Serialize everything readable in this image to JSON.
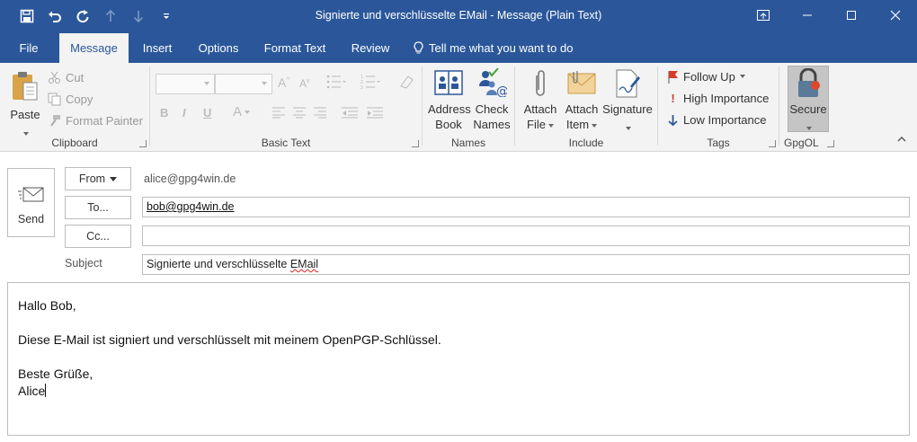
{
  "window": {
    "title": "Signierte und verschlüsselte EMail  -  Message (Plain Text)"
  },
  "colors": {
    "accent": "#2b579a",
    "ribbon_bg": "#f3f3f3",
    "secure_bg": "#c5c5c5"
  },
  "qat": [
    {
      "icon": "save-icon"
    },
    {
      "icon": "undo-icon"
    },
    {
      "icon": "redo-icon"
    },
    {
      "icon": "up-arrow-icon"
    },
    {
      "icon": "down-arrow-icon"
    },
    {
      "icon": "customize-qat-icon"
    }
  ],
  "tabs": [
    {
      "label": "File"
    },
    {
      "label": "Message"
    },
    {
      "label": "Insert"
    },
    {
      "label": "Options"
    },
    {
      "label": "Format Text"
    },
    {
      "label": "Review"
    }
  ],
  "tell_me": "Tell me what you want to do",
  "ribbon": {
    "clipboard": {
      "label": "Clipboard",
      "paste": "Paste",
      "cut": "Cut",
      "copy": "Copy",
      "format_painter": "Format Painter"
    },
    "basic_text": {
      "label": "Basic Text"
    },
    "names": {
      "label": "Names",
      "address_book_1": "Address",
      "address_book_2": "Book",
      "check_names_1": "Check",
      "check_names_2": "Names"
    },
    "include": {
      "label": "Include",
      "attach_file_1": "Attach",
      "attach_file_2": "File",
      "attach_item_1": "Attach",
      "attach_item_2": "Item",
      "signature": "Signature"
    },
    "tags": {
      "label": "Tags",
      "follow_up": "Follow Up",
      "high_importance": "High Importance",
      "low_importance": "Low Importance"
    },
    "gpgol": {
      "label": "GpgOL",
      "secure": "Secure"
    }
  },
  "compose": {
    "send": "Send",
    "from_label": "From",
    "from_address": "alice@gpg4win.de",
    "to_label": "To...",
    "to_value": "bob@gpg4win.de",
    "cc_label": "Cc...",
    "cc_value": "",
    "subject_label": "Subject",
    "subject_value_main": "Signierte und verschlüsselte ",
    "subject_value_squiggle": "EMail",
    "body": {
      "line1": "Hallo Bob,",
      "line2": "",
      "line3": "Diese E-Mail ist signiert und verschlüsselt mit meinem OpenPGP-Schlüssel.",
      "line4": "",
      "line5": "Beste Grüße,",
      "line6": "Alice"
    }
  }
}
